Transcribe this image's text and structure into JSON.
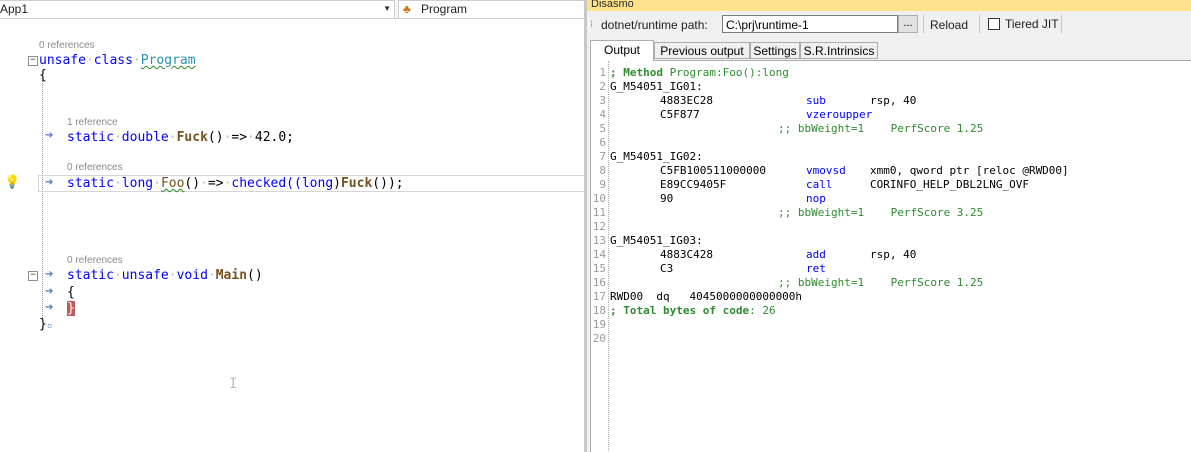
{
  "editor": {
    "project_combo": "App1",
    "class_combo": "Program",
    "codelens": [
      "0 references",
      "1 reference",
      "0 references",
      "0 references"
    ],
    "lines": {
      "class_kw1": "unsafe",
      "class_kw2": "class",
      "class_name": "Program",
      "brace_open": "{",
      "fuck_static": "static",
      "fuck_type": "double",
      "fuck_name": "Fuck",
      "fuck_parens": "()",
      "fuck_arrow": "=>",
      "fuck_value": "42.0;",
      "foo_static": "static",
      "foo_type": "long",
      "foo_name": "Foo",
      "foo_parens": "()",
      "foo_arrow": "=>",
      "foo_checked": "checked((",
      "foo_cast": "long",
      "foo_close": ")",
      "foo_call": "Fuck",
      "foo_end": "());",
      "main_static": "static",
      "main_unsafe": "unsafe",
      "main_void": "void",
      "main_name": "Main",
      "main_parens": "()",
      "main_brace_open": "{",
      "main_brace_close": "}",
      "class_brace_close": "}"
    }
  },
  "disasmo": {
    "title": "Disasmo",
    "path_label": "dotnet/runtime path:",
    "path_value": "C:\\prj\\runtime-1",
    "browse_label": "...",
    "reload_label": "Reload",
    "tiered_jit_label": "Tiered JIT",
    "tiered_jit_checked": false,
    "tabs": [
      "Output",
      "Previous output",
      "Settings",
      "S.R.Intrinsics"
    ],
    "active_tab": "Output",
    "line_numbers": [
      "1",
      "2",
      "3",
      "4",
      "5",
      "6",
      "7",
      "8",
      "9",
      "10",
      "11",
      "12",
      "13",
      "14",
      "15",
      "16",
      "17",
      "18",
      "19",
      "20"
    ],
    "asm": {
      "l1_a": "; Method",
      "l1_b": " Program:Foo():long",
      "l2": "G_M54051_IG01:",
      "l3_hex": "4883EC28",
      "l3_op": "sub",
      "l3_args": "rsp, 40",
      "l4_hex": "C5F877",
      "l4_op": "vzeroupper",
      "l5": ";; bbWeight=1    PerfScore 1.25",
      "l7": "G_M54051_IG02:",
      "l8_hex": "C5FB100511000000",
      "l8_op": "vmovsd",
      "l8_args": "xmm0, qword ptr [reloc @RWD00]",
      "l9_hex": "E89CC9405F",
      "l9_op": "call",
      "l9_args": "CORINFO_HELP_DBL2LNG_OVF",
      "l10_hex": "90",
      "l10_op": "nop",
      "l11": ";; bbWeight=1    PerfScore 3.25",
      "l13": "G_M54051_IG03:",
      "l14_hex": "4883C428",
      "l14_op": "add",
      "l14_args": "rsp, 40",
      "l15_hex": "C3",
      "l15_op": "ret",
      "l16": ";; bbWeight=1    PerfScore 1.25",
      "l17": "RWD00  dq   4045000000000000h",
      "l18_a": "; Total bytes of code",
      "l18_b": ": 26"
    }
  }
}
